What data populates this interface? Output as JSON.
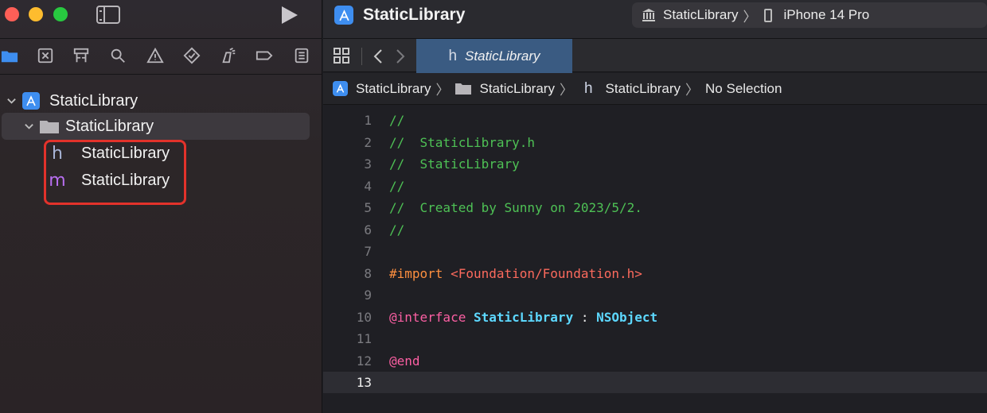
{
  "window": {
    "sidebar_toggle_icon": "sidebar-icon",
    "run_icon": "play-icon"
  },
  "navigator_toolbar": {
    "icons": [
      "folder-icon",
      "source-control-icon",
      "symbol-icon",
      "search-icon",
      "warning-icon",
      "test-icon",
      "debug-icon",
      "breakpoint-icon",
      "report-icon"
    ]
  },
  "navigator": {
    "project": {
      "label": "StaticLibrary"
    },
    "folder": {
      "label": "StaticLibrary"
    },
    "files": [
      {
        "glyph": "h",
        "label": "StaticLibrary"
      },
      {
        "glyph": "m",
        "label": "StaticLibrary"
      }
    ]
  },
  "titlebar": {
    "title": "StaticLibrary",
    "scheme": "StaticLibrary",
    "device": "iPhone 14 Pro"
  },
  "tabbar": {
    "active_tab": {
      "glyph": "h",
      "label": "StaticLibrary"
    }
  },
  "jumpbar": {
    "project": "StaticLibrary",
    "folder": "StaticLibrary",
    "file_glyph": "h",
    "file": "StaticLibrary",
    "selection": "No Selection"
  },
  "code": {
    "current_line": 13,
    "lines": [
      {
        "n": "1",
        "parts": [
          {
            "t": "//",
            "c": "comment"
          }
        ]
      },
      {
        "n": "2",
        "parts": [
          {
            "t": "//  StaticLibrary.h",
            "c": "comment"
          }
        ]
      },
      {
        "n": "3",
        "parts": [
          {
            "t": "//  StaticLibrary",
            "c": "comment"
          }
        ]
      },
      {
        "n": "4",
        "parts": [
          {
            "t": "//",
            "c": "comment"
          }
        ]
      },
      {
        "n": "5",
        "parts": [
          {
            "t": "//  Created by Sunny on 2023/5/2.",
            "c": "comment"
          }
        ]
      },
      {
        "n": "6",
        "parts": [
          {
            "t": "//",
            "c": "comment"
          }
        ]
      },
      {
        "n": "7",
        "parts": []
      },
      {
        "n": "8",
        "parts": [
          {
            "t": "#import ",
            "c": "preproc"
          },
          {
            "t": "<Foundation/Foundation.h>",
            "c": "string"
          }
        ]
      },
      {
        "n": "9",
        "parts": []
      },
      {
        "n": "10",
        "parts": [
          {
            "t": "@interface",
            "c": "keyword"
          },
          {
            "t": " ",
            "c": "plain"
          },
          {
            "t": "StaticLibrary",
            "c": "type"
          },
          {
            "t": " : ",
            "c": "plain"
          },
          {
            "t": "NSObject",
            "c": "type"
          }
        ]
      },
      {
        "n": "11",
        "parts": []
      },
      {
        "n": "12",
        "parts": [
          {
            "t": "@end",
            "c": "keyword"
          }
        ]
      },
      {
        "n": "13",
        "parts": []
      }
    ]
  },
  "colors": {
    "accent": "#3e8ef0",
    "highlight_box": "#e3322b",
    "comment": "#4ec155",
    "keyword": "#fc5fa3",
    "type": "#5dd8ff",
    "string": "#fc6a5d",
    "preproc": "#fd8f3f"
  }
}
